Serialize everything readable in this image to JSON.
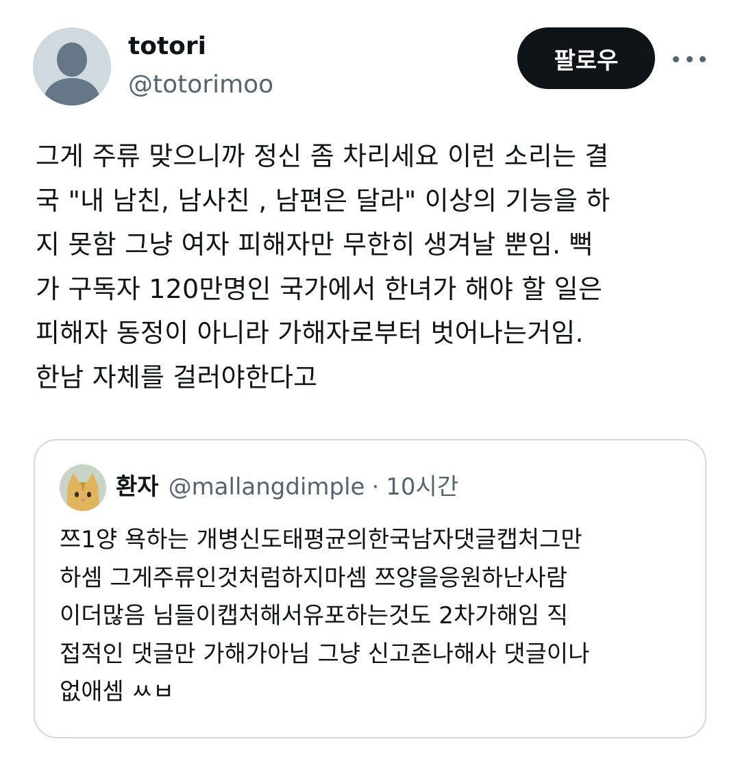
{
  "author": {
    "display_name": "totori",
    "handle": "@totorimoo",
    "avatar_icon": "default-profile-icon"
  },
  "follow_label": "팔로우",
  "more_icon": "more-horizontal-icon",
  "tweet_lines": [
    "그게 주류 맞으니까 정신 좀 차리세요 이런 소리는 결",
    "국 \"내 남친, 남사친 , 남편은 달라\" 이상의 기능을 하",
    "지 못함 그냥 여자 피해자만 무한히 생겨날 뿐임. 뻑",
    "가 구독자 120만명인 국가에서 한녀가 해야 할 일은",
    "피해자 동정이 아니라 가해자로부터 벗어나는거임.",
    "한남 자체를 걸러야한다고"
  ],
  "quote": {
    "display_name": "환자",
    "handle": "@mallangdimple",
    "separator": "·",
    "time": "10시간",
    "avatar_icon": "cat-avatar-icon",
    "lines": [
      "쯔1양 욕하는 개병신도태평균의한국남자댓글캡처그만",
      "하셈 그게주류인것처럼하지마셈 쯔양을응원하난사람",
      "이더많음 님들이캡처해서유포하는것도 2차가해임 직",
      "접적인 댓글만 가해가아님 그냥 신고존나해사 댓글이나",
      "없애셈 ㅆㅂ"
    ]
  },
  "colors": {
    "text_primary": "#0f1419",
    "text_secondary": "#536471",
    "border": "#cfd9de",
    "button_bg": "#0f1419"
  }
}
